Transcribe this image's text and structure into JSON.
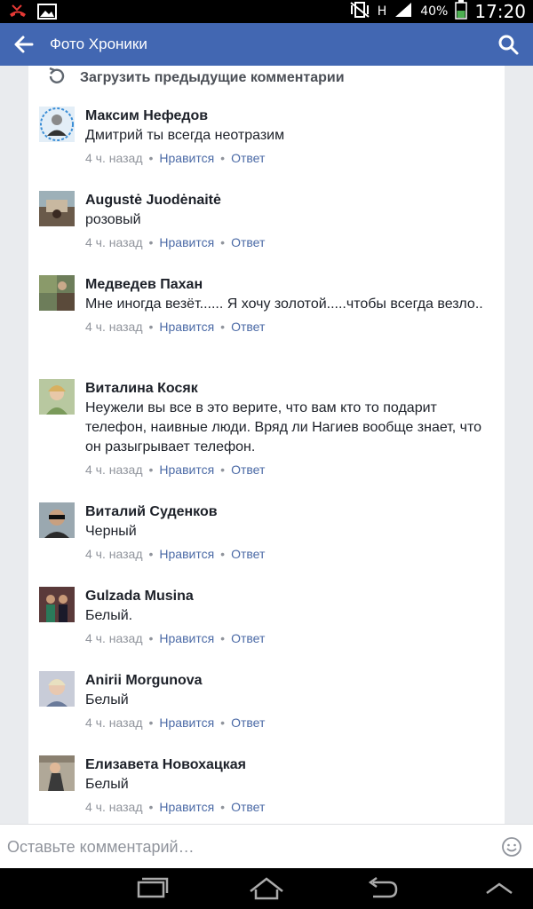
{
  "status_bar": {
    "battery": "40%",
    "time": "17:20",
    "network": "H"
  },
  "app_bar": {
    "title": "Фото Хроники"
  },
  "load_more": "Загрузить предыдущие комментарии",
  "actions": {
    "like": "Нравится",
    "reply": "Ответ",
    "separator": "•"
  },
  "comments": [
    {
      "name": "Максим Нефедов",
      "text": "Дмитрий ты всегда неотразим",
      "time": "4 ч. назад"
    },
    {
      "name": "Augustė Juodėnaitė",
      "text": "розовый",
      "time": "4 ч. назад"
    },
    {
      "name": "Медведев Пахан",
      "text": "Мне иногда везёт...... Я хочу золотой.....чтобы всегда везло..",
      "time": "4 ч. назад"
    },
    {
      "name": "Виталина Косяк",
      "text": "Неужели вы все в это верите, что вам кто то подарит телефон, наивные люди. Вряд ли Нагиев вообще знает, что он разыгрывает телефон.",
      "time": "4 ч. назад"
    },
    {
      "name": "Виталий Суденков",
      "text": "Черный",
      "time": "4 ч. назад"
    },
    {
      "name": "Gulzada Musina",
      "text": "Белый.",
      "time": "4 ч. назад"
    },
    {
      "name": "Anirii Morgunova",
      "text": "Белый",
      "time": "4 ч. назад"
    },
    {
      "name": "Елизавета Новохацкая",
      "text": "Белый",
      "time": "4 ч. назад"
    }
  ],
  "compose": {
    "placeholder": "Оставьте комментарий…"
  },
  "colors": {
    "brand": "#4267b2",
    "link": "#4b6aa6",
    "meta": "#90949c"
  }
}
